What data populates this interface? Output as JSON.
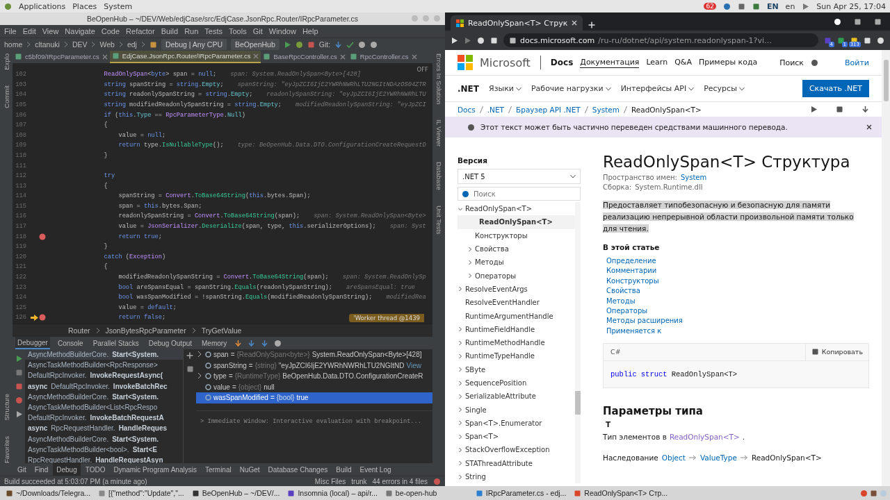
{
  "system_bar": {
    "menus": [
      "Applications",
      "Places",
      "System"
    ],
    "notification_count": "62",
    "keyboard_layout": "EN",
    "language": "en",
    "clock": "Sun Apr 25, 17:04"
  },
  "ide": {
    "title": "BeOpenHub – ~/DEV/Web/edjCase/src/EdjCase.JsonRpc.Router/IRpcParameter.cs",
    "menu": [
      "File",
      "Edit",
      "View",
      "Navigate",
      "Code",
      "Refactor",
      "Build",
      "Run",
      "Tests",
      "Tools",
      "Git",
      "Window",
      "Help"
    ],
    "nav_path": [
      "home",
      "cltanuki",
      "DEV",
      "Web",
      "edj"
    ],
    "configuration": "Debug | Any CPU",
    "run_target": "BeOpenHub",
    "git_label": "Git:",
    "editor_tabs": [
      {
        "label": "c5bf09/IRpcParameter.cs",
        "selected": false
      },
      {
        "label": "EdjCase.JsonRpc.Router/IRpcParameter.cs",
        "selected": true
      },
      {
        "label": "BaseRpcController.cs",
        "selected": false
      },
      {
        "label": "RpcController.cs",
        "selected": false
      }
    ],
    "left_tools": [
      "Explo",
      "Commit",
      "Structure",
      "Favorites"
    ],
    "right_tools": [
      "Errors In Solution",
      "IL Viewer",
      "Database",
      "Unit Tests"
    ],
    "editor": {
      "inspection": "OFF",
      "thread_badge": "'Worker thread @1439",
      "lines": [
        {
          "number": "102",
          "breakpoint": false,
          "current": false,
          "hint": "span: System.ReadOnlySpan<Byte>[428]",
          "tokens": [
            {
              "kind": "type",
              "text": "            ReadOnlySpan"
            },
            {
              "kind": "plain",
              "text": "<"
            },
            {
              "kind": "kw",
              "text": "byte"
            },
            {
              "kind": "plain",
              "text": "> span = "
            },
            {
              "kind": "kw",
              "text": "null"
            },
            {
              "kind": "plain",
              "text": ";"
            }
          ]
        },
        {
          "number": "103",
          "breakpoint": false,
          "current": false,
          "hint": "spanString: \"eyJpZCI6IjE2YWRhNWRhLTU2NGItNDAzOS04ZTR",
          "tokens": [
            {
              "kind": "kw",
              "text": "            string"
            },
            {
              "kind": "plain",
              "text": " spanString = "
            },
            {
              "kind": "kw",
              "text": "string"
            },
            {
              "kind": "plain",
              "text": "."
            },
            {
              "kind": "field",
              "text": "Empty"
            },
            {
              "kind": "plain",
              "text": ";"
            }
          ]
        },
        {
          "number": "104",
          "breakpoint": false,
          "current": false,
          "hint": "readonlySpanString: \"eyJpZCI6IjE2YWRhNWRhLTU",
          "tokens": [
            {
              "kind": "kw",
              "text": "            string"
            },
            {
              "kind": "plain",
              "text": " readonlySpanString = "
            },
            {
              "kind": "kw",
              "text": "string"
            },
            {
              "kind": "plain",
              "text": "."
            },
            {
              "kind": "field",
              "text": "Empty"
            },
            {
              "kind": "plain",
              "text": ";"
            }
          ]
        },
        {
          "number": "105",
          "breakpoint": false,
          "current": false,
          "hint": "modifiedReadonlySpanString: \"eyJpZCI",
          "tokens": [
            {
              "kind": "kw",
              "text": "            string"
            },
            {
              "kind": "plain",
              "text": " modifiedReadonlySpanString = "
            },
            {
              "kind": "kw",
              "text": "string"
            },
            {
              "kind": "plain",
              "text": "."
            },
            {
              "kind": "field",
              "text": "Empty"
            },
            {
              "kind": "plain",
              "text": ";"
            }
          ]
        },
        {
          "number": "106",
          "breakpoint": false,
          "current": false,
          "tokens": [
            {
              "kind": "kw",
              "text": "            if"
            },
            {
              "kind": "plain",
              "text": " ("
            },
            {
              "kind": "kw",
              "text": "this"
            },
            {
              "kind": "plain",
              "text": "."
            },
            {
              "kind": "field",
              "text": "Type"
            },
            {
              "kind": "plain",
              "text": " == "
            },
            {
              "kind": "type",
              "text": "RpcParameterType"
            },
            {
              "kind": "plain",
              "text": "."
            },
            {
              "kind": "field",
              "text": "Null"
            },
            {
              "kind": "plain",
              "text": ")"
            }
          ]
        },
        {
          "number": "107",
          "breakpoint": false,
          "current": false,
          "tokens": [
            {
              "kind": "plain",
              "text": "            {"
            }
          ]
        },
        {
          "number": "108",
          "breakpoint": false,
          "current": false,
          "tokens": [
            {
              "kind": "plain",
              "text": "                value = "
            },
            {
              "kind": "kw",
              "text": "null"
            },
            {
              "kind": "plain",
              "text": ";"
            }
          ]
        },
        {
          "number": "109",
          "breakpoint": false,
          "current": false,
          "hint": "type: BeOpenHub.Data.DTO.ConfigurationCreateRequestD",
          "tokens": [
            {
              "kind": "kw",
              "text": "                return"
            },
            {
              "kind": "plain",
              "text": " type."
            },
            {
              "kind": "method",
              "text": "IsNullableType"
            },
            {
              "kind": "plain",
              "text": "();"
            }
          ]
        },
        {
          "number": "110",
          "breakpoint": false,
          "current": false,
          "tokens": [
            {
              "kind": "plain",
              "text": "            }"
            }
          ]
        },
        {
          "number": "111",
          "breakpoint": false,
          "current": false
        },
        {
          "number": "112",
          "breakpoint": false,
          "current": false,
          "tokens": [
            {
              "kind": "kw",
              "text": "            try"
            }
          ]
        },
        {
          "number": "113",
          "breakpoint": false,
          "current": false,
          "tokens": [
            {
              "kind": "plain",
              "text": "            {"
            }
          ]
        },
        {
          "number": "114",
          "breakpoint": false,
          "current": false,
          "tokens": [
            {
              "kind": "plain",
              "text": "                spanString = "
            },
            {
              "kind": "type",
              "text": "Convert"
            },
            {
              "kind": "plain",
              "text": "."
            },
            {
              "kind": "method",
              "text": "ToBase64String"
            },
            {
              "kind": "plain",
              "text": "("
            },
            {
              "kind": "kw",
              "text": "this"
            },
            {
              "kind": "plain",
              "text": ".bytes.Span);"
            }
          ]
        },
        {
          "number": "115",
          "breakpoint": false,
          "current": false,
          "tokens": [
            {
              "kind": "plain",
              "text": "                span = "
            },
            {
              "kind": "kw",
              "text": "this"
            },
            {
              "kind": "plain",
              "text": ".bytes.Span;"
            }
          ]
        },
        {
          "number": "116",
          "breakpoint": false,
          "current": false,
          "hint": "span: System.ReadOnlySpan<Byte>",
          "tokens": [
            {
              "kind": "plain",
              "text": "                readonlySpanString = "
            },
            {
              "kind": "type",
              "text": "Convert"
            },
            {
              "kind": "plain",
              "text": "."
            },
            {
              "kind": "method",
              "text": "ToBase64String"
            },
            {
              "kind": "plain",
              "text": "(span);"
            }
          ]
        },
        {
          "number": "117",
          "breakpoint": false,
          "current": false,
          "hint": "span: Syst",
          "tokens": [
            {
              "kind": "plain",
              "text": "                value = "
            },
            {
              "kind": "type",
              "text": "JsonSerializer"
            },
            {
              "kind": "plain",
              "text": "."
            },
            {
              "kind": "method",
              "text": "Deserialize"
            },
            {
              "kind": "plain",
              "text": "(span, type, "
            },
            {
              "kind": "kw",
              "text": "this"
            },
            {
              "kind": "plain",
              "text": ".serializerOptions);"
            }
          ]
        },
        {
          "number": "118",
          "breakpoint": true,
          "current": false,
          "tokens": [
            {
              "kind": "kw",
              "text": "                return"
            },
            {
              "kind": "kw",
              "text": " true"
            },
            {
              "kind": "plain",
              "text": ";"
            }
          ]
        },
        {
          "number": "119",
          "breakpoint": false,
          "current": false,
          "tokens": [
            {
              "kind": "plain",
              "text": "            }"
            }
          ]
        },
        {
          "number": "120",
          "breakpoint": false,
          "current": false,
          "tokens": [
            {
              "kind": "kw",
              "text": "            catch"
            },
            {
              "kind": "plain",
              "text": " ("
            },
            {
              "kind": "type",
              "text": "Exception"
            },
            {
              "kind": "plain",
              "text": ")"
            }
          ]
        },
        {
          "number": "121",
          "breakpoint": false,
          "current": false,
          "tokens": [
            {
              "kind": "plain",
              "text": "            {"
            }
          ]
        },
        {
          "number": "122",
          "breakpoint": false,
          "current": false,
          "hint": "span: System.ReadOnlySp",
          "tokens": [
            {
              "kind": "plain",
              "text": "                modifiedReadonlySpanString = "
            },
            {
              "kind": "type",
              "text": "Convert"
            },
            {
              "kind": "plain",
              "text": "."
            },
            {
              "kind": "method",
              "text": "ToBase64String"
            },
            {
              "kind": "plain",
              "text": "(span);"
            }
          ]
        },
        {
          "number": "123",
          "breakpoint": false,
          "current": false,
          "hint": "areSpansEqual: true",
          "tokens": [
            {
              "kind": "kw",
              "text": "                bool"
            },
            {
              "kind": "plain",
              "text": " areSpansEqual = spanString."
            },
            {
              "kind": "method",
              "text": "Equals"
            },
            {
              "kind": "plain",
              "text": "(readonlySpanString);"
            }
          ]
        },
        {
          "number": "124",
          "breakpoint": false,
          "current": false,
          "hint": "modifiedRea",
          "tokens": [
            {
              "kind": "kw",
              "text": "                bool"
            },
            {
              "kind": "plain",
              "text": " wasSpanModified = !spanString."
            },
            {
              "kind": "method",
              "text": "Equals"
            },
            {
              "kind": "plain",
              "text": "(modifiedReadonlySpanString);"
            }
          ]
        },
        {
          "number": "125",
          "breakpoint": false,
          "current": false,
          "tokens": [
            {
              "kind": "plain",
              "text": "                value = "
            },
            {
              "kind": "kw",
              "text": "default"
            },
            {
              "kind": "plain",
              "text": ";"
            }
          ]
        },
        {
          "number": "126",
          "breakpoint": true,
          "current": true,
          "tokens": [
            {
              "kind": "kw",
              "text": "                return"
            },
            {
              "kind": "kw",
              "text": " false"
            },
            {
              "kind": "plain",
              "text": ";"
            }
          ]
        }
      ]
    },
    "breadcrumb": [
      "Router",
      "JsonBytesRpcParameter",
      "TryGetValue"
    ],
    "debug": {
      "tabs": [
        {
          "label": "Debugger",
          "selected": true
        },
        {
          "label": "Console",
          "selected": false
        },
        {
          "label": "Parallel Stacks",
          "selected": false
        },
        {
          "label": "Debug Output",
          "selected": false
        },
        {
          "label": "Memory",
          "selected": false
        }
      ],
      "frames": [
        {
          "text": "AsyncMethodBuilderCore.**Start<System.**",
          "selected": true
        },
        {
          "text": "AsyncTaskMethodBuilder<RpcResponse>",
          "selected": false
        },
        {
          "text": "DefaultRpcInvoker.**InvokeRequestAsync(**",
          "selected": false
        },
        {
          "text": "**async** DefaultRpcInvoker.**InvokeBatchRec**",
          "selected": false
        },
        {
          "text": "AsyncMethodBuilderCore.**Start<System.**",
          "selected": false
        },
        {
          "text": "AsyncTaskMethodBuilder<List<RpcRespo",
          "selected": false
        },
        {
          "text": "DefaultRpcInvoker.**InvokeBatchRequestA**",
          "selected": false
        },
        {
          "text": "**async** RpcRequestHandler.**HandleReques**",
          "selected": false
        },
        {
          "text": "AsyncMethodBuilderCore.**Start<System.**",
          "selected": false
        },
        {
          "text": "AsyncTaskMethodBuilder<bool>.**Start<E**",
          "selected": false
        },
        {
          "text": "RpcRequestHandler.**HandleRequestAsyn**",
          "selected": false
        }
      ],
      "variables": [
        {
          "name": "span",
          "operator": "=",
          "type": "{ReadOnlySpan<byte>}",
          "value": "System.ReadOnlySpan<Byte>[428]",
          "expandable": true,
          "selected": false
        },
        {
          "name": "spanString",
          "operator": "=",
          "type": "{string}",
          "value": "\"eyJpZCI6IjE2YWRhNWRhLTU2NGItND",
          "link": "View",
          "expandable": false,
          "selected": false
        },
        {
          "name": "type",
          "operator": "=",
          "type": "{RuntimeType}",
          "value": "BeOpenHub.Data.DTO.ConfigurationCreateR",
          "expandable": true,
          "selected": false
        },
        {
          "name": "value",
          "operator": "=",
          "type": "{object}",
          "value": "null",
          "expandable": false,
          "selected": false
        },
        {
          "name": "wasSpanModified",
          "operator": "=",
          "type": "{bool}",
          "value": "true",
          "expandable": false,
          "selected": true
        }
      ],
      "immediate": "> Immediate Window: Interactive evaluation with breakpoint..."
    },
    "tool_tabs": [
      {
        "label": "Git",
        "selected": false
      },
      {
        "label": "Find",
        "selected": false
      },
      {
        "label": "Debug",
        "selected": true
      },
      {
        "label": "TODO",
        "selected": false
      },
      {
        "label": "Dynamic Program Analysis",
        "selected": false
      },
      {
        "label": "Terminal",
        "selected": false
      },
      {
        "label": "NuGet",
        "selected": false
      },
      {
        "label": "Database Changes",
        "selected": false
      },
      {
        "label": "Build",
        "selected": false
      },
      {
        "label": "Event Log",
        "selected": false
      }
    ],
    "status": {
      "message": "Build succeeded at 5:03:07 PM (a minute ago)",
      "context": "Misc Files",
      "branch": "trunk",
      "errors": "44 errors in 4 files"
    }
  },
  "browser": {
    "tab_title": "ReadOnlySpan<T> Струк",
    "url_host": "docs.microsoft.com",
    "url_path": "/ru-ru/dotnet/api/system.readonlyspan-1?vi…",
    "extension_badges": [
      "4",
      "1",
      "313"
    ],
    "page": {
      "brand": "Microsoft",
      "product": "Docs",
      "nav": [
        {
          "label": "Документация",
          "selected": true
        },
        {
          "label": "Learn",
          "selected": false
        },
        {
          "label": "Q&A",
          "selected": false
        },
        {
          "label": "Примеры кода",
          "selected": false
        }
      ],
      "search": "Поиск",
      "sign_in": "Войти",
      "section": ".NET",
      "subnav": [
        "Языки",
        "Рабочие нагрузки",
        "Интерфейсы API",
        "Ресурсы"
      ],
      "download": "Скачать .NET",
      "breadcrumb": [
        "Docs",
        ".NET",
        "Браузер API .NET",
        "System",
        "ReadOnlySpan<T>"
      ],
      "notice": "Этот текст может быть частично переведен средствами машинного перевода.",
      "version_label": "Версия",
      "version": ".NET 5",
      "filter_placeholder": "Поиск",
      "toc": [
        {
          "label": "ReadOnlySpan<T>",
          "selected": false,
          "expandable": true,
          "children": [
            {
              "label": "ReadOnlySpan<T>",
              "selected": true,
              "expandable": false
            },
            {
              "label": "Конструкторы",
              "selected": false,
              "expandable": false
            },
            {
              "label": "Свойства",
              "selected": false,
              "expandable": true
            },
            {
              "label": "Методы",
              "selected": false,
              "expandable": true
            },
            {
              "label": "Операторы",
              "selected": false,
              "expandable": true
            }
          ]
        },
        {
          "label": "ResolveEventArgs",
          "selected": false,
          "expandable": true
        },
        {
          "label": "ResolveEventHandler",
          "selected": false,
          "expandable": false
        },
        {
          "label": "RuntimeArgumentHandle",
          "selected": false,
          "expandable": false
        },
        {
          "label": "RuntimeFieldHandle",
          "selected": false,
          "expandable": true
        },
        {
          "label": "RuntimeMethodHandle",
          "selected": false,
          "expandable": true
        },
        {
          "label": "RuntimeTypeHandle",
          "selected": false,
          "expandable": true
        },
        {
          "label": "SByte",
          "selected": false,
          "expandable": true
        },
        {
          "label": "SequencePosition",
          "selected": false,
          "expandable": true
        },
        {
          "label": "SerializableAttribute",
          "selected": false,
          "expandable": true
        },
        {
          "label": "Single",
          "selected": false,
          "expandable": true
        },
        {
          "label": "Span<T>.Enumerator",
          "selected": false,
          "expandable": true
        },
        {
          "label": "Span<T>",
          "selected": false,
          "expandable": true
        },
        {
          "label": "StackOverflowException",
          "selected": false,
          "expandable": true
        },
        {
          "label": "STAThreadAttribute",
          "selected": false,
          "expandable": true
        },
        {
          "label": "String",
          "selected": false,
          "expandable": true
        }
      ],
      "title": "ReadOnlySpan<T> Структура",
      "namespace_label": "Пространство имен:",
      "namespace": "System",
      "assembly_label": "Сборка:",
      "assembly": "System.Runtime.dll",
      "summary": "Предоставляет типобезопасную и безопасную для памяти реализацию непрерывной области произвольной памяти только для чтения.",
      "in_article": "В этой статье",
      "article_links": [
        "Определение",
        "Комментарии",
        "Конструкторы",
        "Свойства",
        "Методы",
        "Операторы",
        "Методы расширения",
        "Применяется к"
      ],
      "code_language": "C#",
      "copy": "Копировать",
      "code": [
        {
          "kind": "kw",
          "text": "public"
        },
        {
          "kind": "kw",
          "text": "struct"
        },
        {
          "kind": "plain",
          "text": "ReadOnlySpan<T>"
        }
      ],
      "params_heading": "Параметры типа",
      "param_name": "T",
      "param_text": "Тип элементов в",
      "param_link": "ReadOnlySpan<T>",
      "param_end": ".",
      "inheritance_label": "Наследование",
      "inheritance": [
        {
          "text": "Object",
          "link": true
        },
        {
          "text": "ValueType",
          "link": true
        },
        {
          "text": "ReadOnlySpan<T>",
          "link": false
        }
      ]
    }
  },
  "taskbar": {
    "items": [
      "~/Downloads/Telegra...",
      "[{\"method\":\"Update\",\"...",
      "BeOpenHub – ~/DEV/...",
      "Insomnia (local) – api/r...",
      "be-open-hub",
      "IRpcParameter.cs - edj...",
      "ReadOnlySpan<T> Стр..."
    ]
  }
}
